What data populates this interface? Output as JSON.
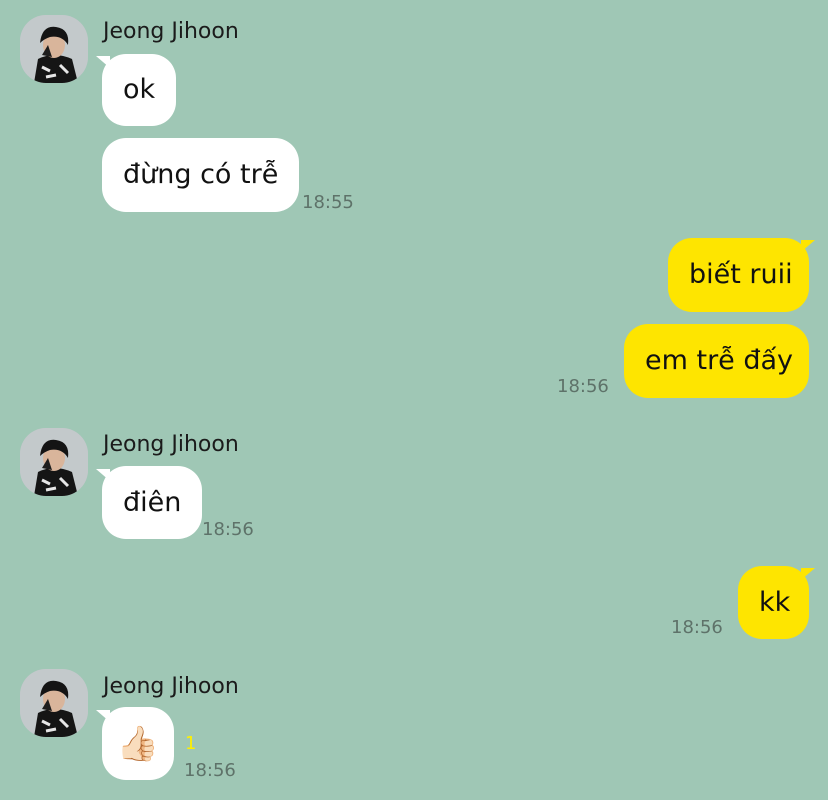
{
  "chat": {
    "contact_name": "Jeong Jihoon",
    "colors": {
      "background": "#9fc7b5",
      "incoming": "#ffffff",
      "outgoing": "#fee500",
      "unread": "#ffef00"
    },
    "groups": [
      {
        "sender": "Jeong Jihoon",
        "messages": [
          "ok",
          "đừng có trễ"
        ],
        "time": "18:55"
      },
      {
        "sender": "me",
        "messages": [
          "biết ruii",
          "em trễ đấy"
        ],
        "time": "18:56"
      },
      {
        "sender": "Jeong Jihoon",
        "messages": [
          "điên"
        ],
        "time": "18:56"
      },
      {
        "sender": "me",
        "messages": [
          "kk"
        ],
        "time": "18:56"
      },
      {
        "sender": "Jeong Jihoon",
        "messages": [
          "👍🏻"
        ],
        "unread": "1",
        "time": "18:56"
      }
    ]
  }
}
